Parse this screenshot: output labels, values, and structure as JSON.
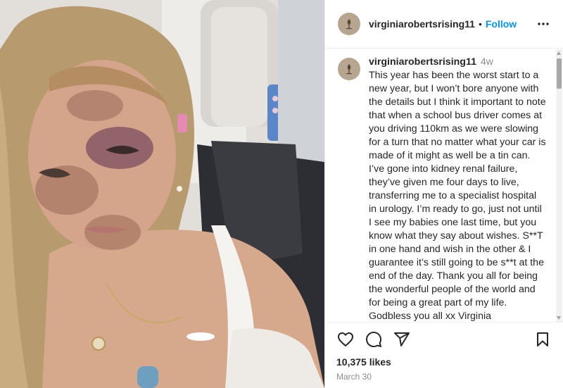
{
  "post": {
    "username": "virginiarobertsrising11",
    "separator": "•",
    "follow_label": "Follow",
    "caption": {
      "username": "virginiarobertsrising11",
      "time": "4w",
      "text": "This year has been the worst start to a new year, but I won’t bore anyone with the details but I think it important to note that when a school bus driver comes at you driving 110km as we were slowing for a turn that no matter what your car is made of it might as well be a tin can. I’ve gone into kidney renal failure, they’ve given me four days to live, transferring me to a specialist hospital in urology. I’m ready to go, just not until I see my babies one last time, but you know what they say about wishes. S**T in one hand and wish in the other & I guarantee it’s still going to be s**t at the end of the day. Thank you all for being the wonderful people of the world and for being a great part of my life. Godbless you all xx Virginia",
      "emojis": "🙏❤️🎀"
    },
    "likes": "10,375 likes",
    "date": "March 30"
  },
  "icons": {
    "more": "more-options-icon",
    "like": "heart-icon",
    "comment": "comment-icon",
    "share": "paper-plane-icon",
    "save": "bookmark-icon",
    "avatar": "profile-avatar"
  },
  "colors": {
    "follow": "#0095f6",
    "muted": "#8e8e8e",
    "text": "#262626",
    "divider": "#efefef"
  }
}
